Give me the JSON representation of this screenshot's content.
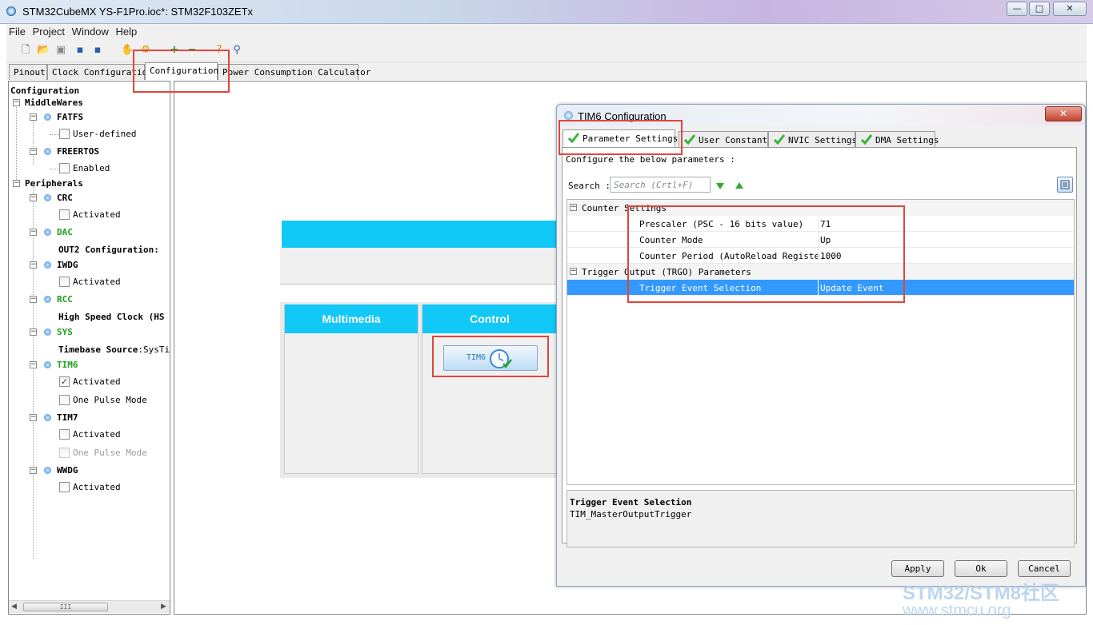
{
  "window": {
    "title": "STM32CubeMX YS-F1Pro.ioc*: STM32F103ZETx",
    "min": "—",
    "max": "□",
    "close": "✕"
  },
  "menu": [
    "File",
    "Project",
    "Window",
    "Help"
  ],
  "tabs": [
    "Pinout",
    "Clock Configuration",
    "Configuration",
    "Power Consumption Calculator"
  ],
  "tree": {
    "root": "Configuration",
    "middlewares": "MiddleWares",
    "fatfs": "FATFS",
    "fatfs_opt": "User-defined",
    "freertos": "FREERTOS",
    "freertos_opt": "Enabled",
    "peripherals": "Peripherals",
    "crc": "CRC",
    "crc_opt": "Activated",
    "dac": "DAC",
    "dac_opt": "OUT2 Configuration:",
    "iwdg": "IWDG",
    "iwdg_opt": "Activated",
    "rcc": "RCC",
    "rcc_opt": "High Speed Clock (HS",
    "sys": "SYS",
    "sys_opt_label": "Timebase Source",
    "sys_opt_val": ":SysTi",
    "tim6": "TIM6",
    "tim6_opt1": "Activated",
    "tim6_opt2": "One Pulse Mode",
    "tim7": "TIM7",
    "tim7_opt1": "Activated",
    "tim7_opt2": "One Pulse Mode",
    "wwdg": "WWDG",
    "wwdg_opt": "Activated",
    "scroll_grip": "III"
  },
  "main": {
    "multimedia": "Multimedia",
    "control": "Control",
    "tim6_button": "TIM6"
  },
  "dialog": {
    "title": "TIM6 Configuration",
    "tabs": [
      "Parameter Settings",
      "User Constants",
      "NVIC Settings",
      "DMA Settings"
    ],
    "instructions": "Configure the below parameters :",
    "search_label": "Search :",
    "search_placeholder": "Search (Crtl+F)",
    "groups": [
      {
        "name": "Counter Settings",
        "toggle": "⊟"
      },
      {
        "name": "Trigger Output (TRGO) Parameters",
        "toggle": "⊟"
      }
    ],
    "params": [
      {
        "name": "Prescaler (PSC - 16 bits value)",
        "value": "71"
      },
      {
        "name": "Counter Mode",
        "value": "Up"
      },
      {
        "name": "Counter Period (AutoReload Registe...",
        "value": "1000"
      },
      {
        "name": "Trigger Event Selection",
        "value": "Update Event"
      }
    ],
    "desc_title": "Trigger Event Selection",
    "desc_text": "TIM_MasterOutputTrigger",
    "apply": "Apply",
    "ok": "Ok",
    "cancel": "Cancel"
  },
  "watermark": {
    "line1": "STM32/STM8社区",
    "line2": "www.stmcu.org"
  },
  "colors": {
    "accent": "#11c8f7",
    "selection": "#3399ff",
    "highlight": "#e0463b",
    "tree_green": "#1aa31a"
  }
}
